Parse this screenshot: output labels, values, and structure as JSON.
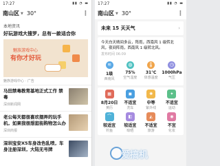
{
  "left": {
    "status_time": "17:27",
    "status_icons": "▮▮ ◔ ▬",
    "location": "南山区",
    "temperature": "30°",
    "section": "本地资讯",
    "headline": "好玩游戏大搜罗，总有一款适合你",
    "banner_line1": "魅族游戏中心",
    "banner_line2": "有你才好玩",
    "source": "魅族游戏中心 · 广告",
    "news": [
      {
        "title": "马田禁毒教育基地正式工作 禁毒",
        "meta": "深圳新闻网"
      },
      {
        "title": "老公每天都很喜欢摆弄的玩手机，如果我很想逛街购物怎么办",
        "meta": "深圳商报"
      },
      {
        "title": "深圳宝安X5车身改色乱喷，车身注册深圳，大陆无号牌",
        "meta": ""
      }
    ]
  },
  "right": {
    "status_time": "17:27",
    "location": "南山区",
    "temperature": "30°",
    "forecast": "未来 15 天天气",
    "weather_text": "今天白天晴间多云，阵雨，西南风 1 级转北风，夜间阵雨，西南风 1 级转北风。",
    "update_time": "发布时间 06:09",
    "metrics": [
      {
        "value": "1级",
        "label": "西南风",
        "icon": "wind-icon",
        "color": "#5aa9e6",
        "glyph": "≋"
      },
      {
        "value": "75%",
        "label": "空气湿度",
        "icon": "humidity-icon",
        "color": "#4fc1c1",
        "glyph": "◍"
      },
      {
        "value": "31℃",
        "label": "体感温度",
        "icon": "thermometer-icon",
        "color": "#f0a44a",
        "glyph": "🌡"
      },
      {
        "value": "1000hPa",
        "label": "气压",
        "icon": "pressure-icon",
        "color": "#8f8fe0",
        "glyph": "◷"
      }
    ],
    "tiles": [
      {
        "value": "8月20日",
        "label": "黄历",
        "color": "#e06b5a",
        "icon": "calendar-icon",
        "glyph": "▦"
      },
      {
        "value": "不适宜",
        "label": "洗车",
        "color": "#4a9fe0",
        "icon": "car-wash-icon",
        "glyph": "◼"
      },
      {
        "value": "中等",
        "label": "紫外线",
        "color": "#f2b84b",
        "icon": "uv-icon",
        "glyph": "✺"
      },
      {
        "value": "不适宜",
        "label": "运动",
        "color": "#5cc08a",
        "icon": "sport-icon",
        "glyph": "✦"
      },
      {
        "value": "较适宜",
        "label": "钓鱼",
        "color": "#4fb2d8",
        "icon": "fishing-icon",
        "glyph": "⌒"
      },
      {
        "value": "较适宜",
        "label": "晾晒",
        "color": "#a68be0",
        "icon": "drying-icon",
        "glyph": "◧"
      },
      {
        "value": "不适宜",
        "label": "旅游",
        "color": "#e68b5a",
        "icon": "travel-icon",
        "glyph": "◭"
      },
      {
        "value": "不宜",
        "label": "化妆",
        "color": "#e07aa3",
        "icon": "makeup-icon",
        "glyph": "◉"
      }
    ],
    "watermark": "爱搞机"
  }
}
